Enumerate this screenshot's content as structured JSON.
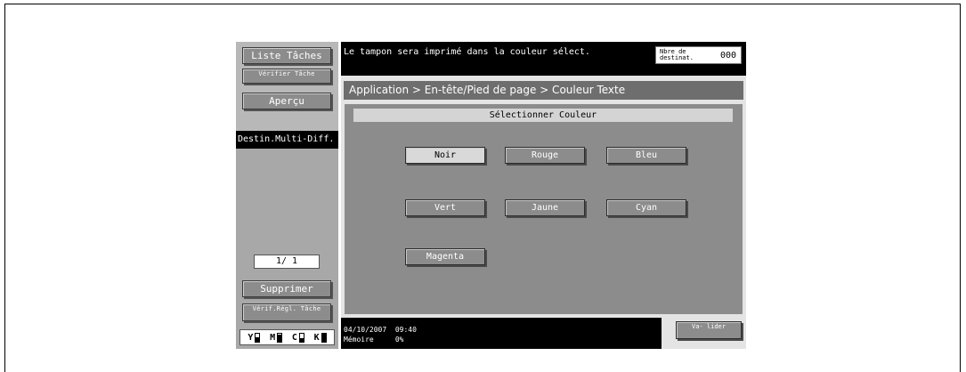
{
  "message": "Le tampon sera imprimé dans la couleur sélect.",
  "destination_count": {
    "label": "Nbre de destinat.",
    "value": "000"
  },
  "left_panel": {
    "liste_taches": "Liste Tâches",
    "verifier_tache": "Vérifier Tâche",
    "apercu": "Aperçu",
    "destin_multi_diff": "Destin.Multi-Diff.",
    "page_indicator": "1/ 1",
    "supprimer": "Supprimer",
    "verif_regl_tache": "Vérif.Régl. Tâche"
  },
  "breadcrumb": "Application > En-tête/Pied de page > Couleur Texte",
  "section_header": "Sélectionner Couleur",
  "colors": [
    {
      "label": "Noir",
      "selected": true
    },
    {
      "label": "Rouge",
      "selected": false
    },
    {
      "label": "Bleu",
      "selected": false
    },
    {
      "label": "Vert",
      "selected": false
    },
    {
      "label": "Jaune",
      "selected": false
    },
    {
      "label": "Cyan",
      "selected": false
    },
    {
      "label": "Magenta",
      "selected": false
    }
  ],
  "status": {
    "date": "04/10/2007",
    "time": "09:40",
    "memory_label": "Mémoire",
    "memory_value": "0%"
  },
  "valider": "Va- lider",
  "toner": [
    {
      "label": "Y",
      "level": 0.5
    },
    {
      "label": "M",
      "level": 0.8
    },
    {
      "label": "C",
      "level": 0.4
    },
    {
      "label": "K",
      "level": 0.9
    }
  ],
  "theme": {
    "button_gray": "#8c8c8c",
    "selected_button": "#d9d9d9",
    "status_bar": "#000000",
    "breadcrumb_bar": "#6e6e6e"
  }
}
